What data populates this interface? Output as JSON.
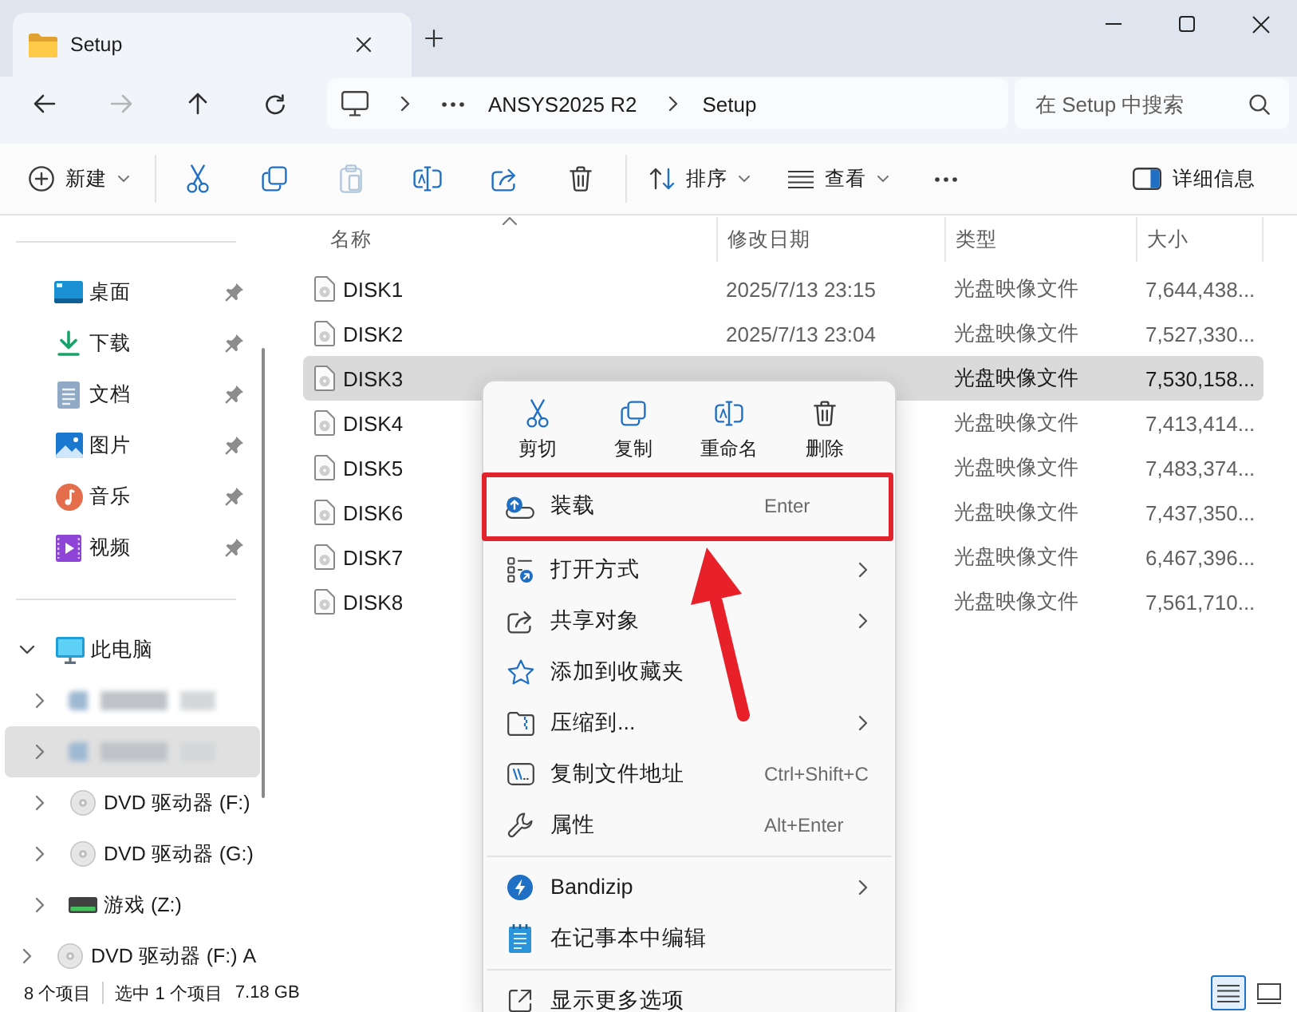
{
  "window": {
    "tab": {
      "title": "Setup",
      "selected": true
    }
  },
  "navigation": {
    "buttons": [
      {
        "kind": "back",
        "disabled": false
      },
      {
        "kind": "forward",
        "disabled": true
      },
      {
        "kind": "up",
        "disabled": false
      },
      {
        "kind": "refresh",
        "disabled": false
      }
    ]
  },
  "address_bar": {
    "segments": [
      {
        "kind": "computer",
        "chevron": true
      },
      {
        "kind": "overflow",
        "chevron": false
      },
      {
        "kind": "folder",
        "label": "ANSYS2025 R2",
        "chevron": true
      },
      {
        "kind": "folder",
        "label": "Setup",
        "chevron": false
      }
    ]
  },
  "search": {
    "placeholder": "在 Setup 中搜索"
  },
  "toolbar": {
    "groups": [
      {
        "items": [
          {
            "kind": "new",
            "label": "新建",
            "dropdown": true,
            "disabled": false
          }
        ]
      },
      {
        "items": [
          {
            "kind": "cut",
            "dropdown": false,
            "disabled": false
          },
          {
            "kind": "copy",
            "dropdown": false,
            "disabled": false
          },
          {
            "kind": "paste",
            "dropdown": false,
            "disabled": true
          },
          {
            "kind": "rename",
            "dropdown": false,
            "disabled": false
          },
          {
            "kind": "share",
            "dropdown": false,
            "disabled": false
          },
          {
            "kind": "delete",
            "dropdown": false,
            "disabled": false
          }
        ]
      },
      {
        "items": [
          {
            "kind": "sort",
            "label": "排序",
            "dropdown": true,
            "disabled": false
          },
          {
            "kind": "view",
            "label": "查看",
            "dropdown": true,
            "disabled": false
          },
          {
            "kind": "more",
            "dropdown": false,
            "disabled": false
          }
        ]
      }
    ],
    "end_items": [
      {
        "kind": "details",
        "label": "详细信息",
        "dropdown": false,
        "disabled": false
      }
    ]
  },
  "sidebar": {
    "quick_access": [
      {
        "kind": "desktop",
        "label": "桌面",
        "pinned": true
      },
      {
        "kind": "downloads",
        "label": "下载",
        "pinned": true
      },
      {
        "kind": "documents",
        "label": "文档",
        "pinned": true
      },
      {
        "kind": "pictures",
        "label": "图片",
        "pinned": true
      },
      {
        "kind": "music",
        "label": "音乐",
        "pinned": true
      },
      {
        "kind": "videos",
        "label": "视频",
        "pinned": true
      }
    ],
    "tree": [
      {
        "kind": "pc",
        "label": "此电脑",
        "expanded": true,
        "selected": false,
        "children": [
          {
            "kind": "redacted",
            "expanded": false,
            "selected": false
          },
          {
            "kind": "redacted",
            "expanded": false,
            "selected": true
          },
          {
            "kind": "dvd",
            "label": "DVD 驱动器 (F:)",
            "expanded": false,
            "selected": false
          },
          {
            "kind": "dvd",
            "label": "DVD 驱动器 (G:)",
            "expanded": false,
            "selected": false
          },
          {
            "kind": "drive",
            "label": "游戏 (Z:)",
            "expanded": false,
            "selected": false
          }
        ]
      },
      {
        "kind": "dvd",
        "label": "DVD 驱动器 (F:) A",
        "expanded": false,
        "selected": false
      }
    ]
  },
  "file_list": {
    "columns": [
      {
        "label": "名称",
        "sorted": true
      },
      {
        "label": "修改日期",
        "sorted": false
      },
      {
        "label": "类型",
        "sorted": false
      },
      {
        "label": "大小",
        "sorted": false
      }
    ],
    "rows": [
      {
        "name": "DISK1",
        "modified": "2025/7/13 23:15",
        "type": "光盘映像文件",
        "size": "7,644,438...",
        "selected": false
      },
      {
        "name": "DISK2",
        "modified": "2025/7/13 23:04",
        "type": "光盘映像文件",
        "size": "7,527,330...",
        "selected": false
      },
      {
        "name": "DISK3",
        "type": "光盘映像文件",
        "size": "7,530,158...",
        "selected": true
      },
      {
        "name": "DISK4",
        "type": "光盘映像文件",
        "size": "7,413,414...",
        "selected": false
      },
      {
        "name": "DISK5",
        "type": "光盘映像文件",
        "size": "7,483,374...",
        "selected": false
      },
      {
        "name": "DISK6",
        "type": "光盘映像文件",
        "size": "7,437,350...",
        "selected": false
      },
      {
        "name": "DISK7",
        "type": "光盘映像文件",
        "size": "6,467,396...",
        "selected": false
      },
      {
        "name": "DISK8",
        "type": "光盘映像文件",
        "size": "7,561,710...",
        "selected": false
      }
    ]
  },
  "context_menu": {
    "quick_actions": [
      {
        "kind": "cut",
        "label": "剪切"
      },
      {
        "kind": "copy",
        "label": "复制"
      },
      {
        "kind": "rename",
        "label": "重命名"
      },
      {
        "kind": "delete",
        "label": "删除"
      }
    ],
    "groups": [
      {
        "items": [
          {
            "kind": "mount",
            "label": "装载",
            "shortcut": "Enter",
            "submenu": false,
            "highlighted": true
          },
          {
            "kind": "open-with",
            "label": "打开方式",
            "submenu": true,
            "highlighted": false
          },
          {
            "kind": "share",
            "label": "共享对象",
            "submenu": true,
            "highlighted": false
          },
          {
            "kind": "favorite",
            "label": "添加到收藏夹",
            "submenu": false,
            "highlighted": false
          },
          {
            "kind": "compress",
            "label": "压缩到...",
            "submenu": true,
            "highlighted": false
          },
          {
            "kind": "copy-path",
            "label": "复制文件地址",
            "shortcut": "Ctrl+Shift+C",
            "submenu": false,
            "highlighted": false
          },
          {
            "kind": "properties",
            "label": "属性",
            "shortcut": "Alt+Enter",
            "submenu": false,
            "highlighted": false
          }
        ]
      },
      {
        "items": [
          {
            "kind": "bandizip",
            "label": "Bandizip",
            "submenu": true,
            "highlighted": false
          },
          {
            "kind": "notepad",
            "label": "在记事本中编辑",
            "submenu": false,
            "highlighted": false
          }
        ]
      },
      {
        "items": [
          {
            "kind": "more-options",
            "label": "显示更多选项",
            "submenu": false,
            "highlighted": false
          }
        ]
      }
    ]
  },
  "status_bar": {
    "item_count": "8 个项目",
    "selection": "选中 1 个项目",
    "selection_size": "7.18 GB",
    "views": [
      {
        "kind": "details",
        "selected": true
      },
      {
        "kind": "tiles",
        "selected": false
      }
    ]
  }
}
